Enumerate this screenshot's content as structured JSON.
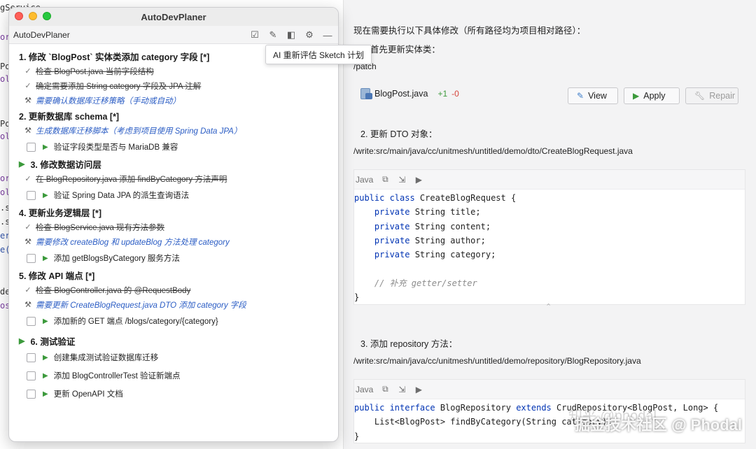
{
  "background_editor": {
    "fragments": [
      "gService",
      "ory",
      "Post",
      "olo",
      "Post",
      "olo",
      "ory",
      "olo",
      ".s",
      ".s",
      "err",
      "e(",
      "de",
      "osi"
    ]
  },
  "right_panel": {
    "intro": "现在需要执行以下具体修改（所有路径均为项目相对路径）：",
    "step1": "1. 首先更新实体类：",
    "step1_path": "/patch",
    "file": {
      "name": "BlogPost.java",
      "added": "+1",
      "removed": "-0"
    },
    "buttons": {
      "view": "View",
      "apply": "Apply",
      "repair": "Repair"
    },
    "step2": "2. 更新 DTO 对象：",
    "step2_path": "/write:src/main/java/cc/unitmesh/untitled/demo/dto/CreateBlogRequest.java",
    "code1": {
      "lang": "Java",
      "lines": [
        "public class CreateBlogRequest {",
        "    private String title;",
        "    private String content;",
        "    private String author;",
        "    private String category;",
        "",
        "    // 补充 getter/setter",
        "}"
      ]
    },
    "step3": "3. 添加 repository 方法：",
    "step3_path": "/write:src/main/java/cc/unitmesh/untitled/demo/repository/BlogRepository.java",
    "code2": {
      "lang": "Java",
      "lines": [
        "public interface BlogRepository extends CrudRepository<BlogPost, Long> {",
        "    List<BlogPost> findByCategory(String category);",
        "}"
      ]
    },
    "watermark": "掘金技术社区 @ Phodal",
    "watermark_faint": "知乎 @phodal"
  },
  "planner": {
    "window_title": "AutoDevPlaner",
    "toolbar_title": "AutoDevPlaner",
    "tooltip": "AI 重新评估 Sketch 计划",
    "sections": [
      {
        "title": "1. 修改 `BlogPost` 实体类添加 category 字段 [*]",
        "items": [
          {
            "type": "done",
            "text": "检查 BlogPost.java 当前字段结构"
          },
          {
            "type": "done",
            "text": "确定需要添加 String category 字段及 JPA 注解"
          },
          {
            "type": "tool",
            "text": "需要确认数据库迁移策略（手动或自动）"
          }
        ]
      },
      {
        "title": "2. 更新数据库 schema [*]",
        "items": [
          {
            "type": "tool",
            "text": "生成数据库迁移脚本（考虑到项目使用 Spring Data JPA）"
          },
          {
            "type": "todo",
            "text": "验证字段类型是否与 MariaDB 兼容"
          }
        ]
      },
      {
        "title": "3. 修改数据访问层",
        "items": [
          {
            "type": "done",
            "text": "在 BlogRepository.java 添加 findByCategory 方法声明"
          },
          {
            "type": "todo",
            "text": "验证 Spring Data JPA 的派生查询语法"
          }
        ]
      },
      {
        "title": "4. 更新业务逻辑层 [*]",
        "items": [
          {
            "type": "done",
            "text": "检查 BlogService.java 现有方法参数"
          },
          {
            "type": "tool",
            "text": "需要修改 createBlog 和 updateBlog 方法处理 category"
          },
          {
            "type": "todo",
            "text": "添加 getBlogsByCategory 服务方法"
          }
        ]
      },
      {
        "title": "5. 修改 API 端点 [*]",
        "items": [
          {
            "type": "done",
            "text": "检查 BlogController.java 的 @RequestBody"
          },
          {
            "type": "tool",
            "text": "需要更新 CreateBlogRequest.java DTO 添加 category 字段"
          },
          {
            "type": "todo",
            "text": "添加新的 GET 端点 /blogs/category/{category}"
          }
        ]
      },
      {
        "title": "6. 测试验证",
        "items": [
          {
            "type": "todo",
            "text": "创建集成测试验证数据库迁移"
          },
          {
            "type": "todo",
            "text": "添加 BlogControllerTest 验证新端点"
          },
          {
            "type": "todo",
            "text": "更新 OpenAPI 文档"
          }
        ]
      }
    ]
  }
}
